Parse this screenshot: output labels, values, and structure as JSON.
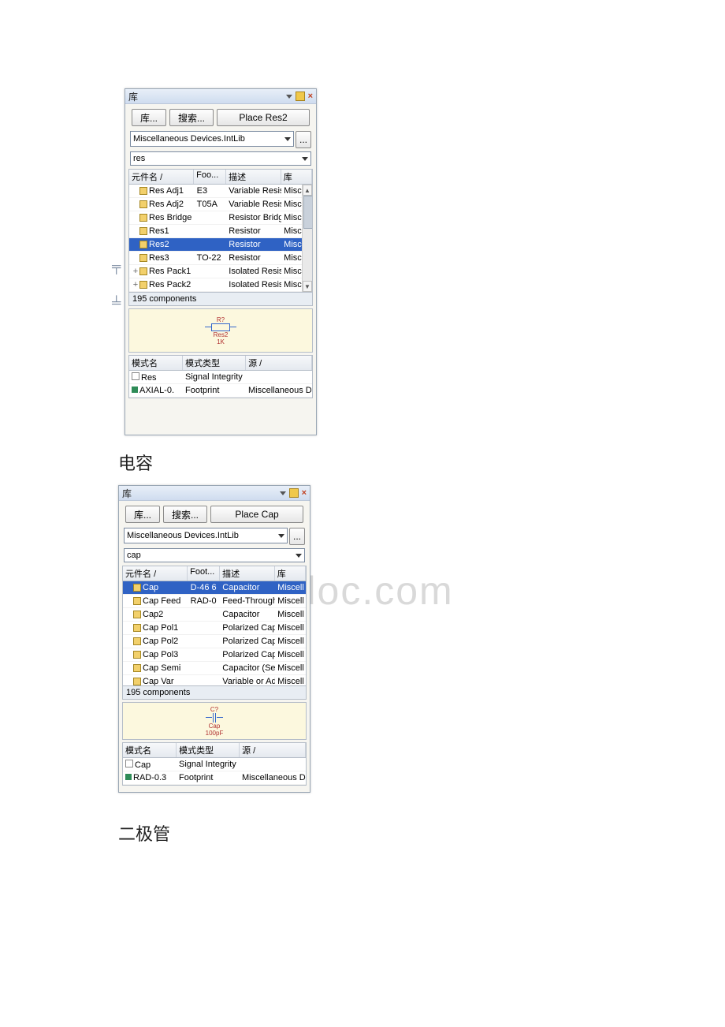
{
  "captions": {
    "capacitor": "电容",
    "diode": "二极管"
  },
  "watermark": "ingdoc.com",
  "panel1": {
    "title": "库",
    "toolbar": {
      "library_btn": "库...",
      "search_btn": "搜索...",
      "place_btn": "Place Res2"
    },
    "lib_select": "Miscellaneous Devices.IntLib",
    "more_btn": "...",
    "filter_value": "res",
    "columns": {
      "name": "元件名",
      "sort": "/",
      "foot": "Foo...",
      "desc": "描述",
      "lib": "库"
    },
    "rows": [
      {
        "tree": "",
        "name": "Res Adj1",
        "foot": "E3",
        "desc": "Variable Resis",
        "lib": "Miscell",
        "sel": false
      },
      {
        "tree": "",
        "name": "Res Adj2",
        "foot": "T05A",
        "desc": "Variable Resis",
        "lib": "Miscell",
        "sel": false
      },
      {
        "tree": "",
        "name": "Res Bridge",
        "foot": "",
        "desc": "Resistor Bridg",
        "lib": "Miscell",
        "sel": false
      },
      {
        "tree": "",
        "name": "Res1",
        "foot": "",
        "desc": "Resistor",
        "lib": "Miscell",
        "sel": false
      },
      {
        "tree": "",
        "name": "Res2",
        "foot": "",
        "desc": "Resistor",
        "lib": "Miscell",
        "sel": true
      },
      {
        "tree": "",
        "name": "Res3",
        "foot": "TO-22",
        "desc": "Resistor",
        "lib": "Miscell",
        "sel": false
      },
      {
        "tree": "+",
        "name": "Res Pack1",
        "foot": "",
        "desc": "Isolated Resis",
        "lib": "Miscell",
        "sel": false
      },
      {
        "tree": "+",
        "name": "Res Pack2",
        "foot": "",
        "desc": "Isolated Resis",
        "lib": "Miscell",
        "sel": false
      }
    ],
    "count_text": "195 components",
    "preview": {
      "designator": "R?",
      "comment": "Res2",
      "value": "1K"
    },
    "models": {
      "columns": {
        "name": "模式名",
        "type": "模式类型",
        "src": "源",
        "sort": "/"
      },
      "rows": [
        {
          "icon": "sch",
          "name": "Res",
          "type": "Signal Integrity",
          "src": ""
        },
        {
          "icon": "fp",
          "name": "AXIAL-0.",
          "type": "Footprint",
          "src": "Miscellaneous D"
        }
      ]
    }
  },
  "panel2": {
    "title": "库",
    "toolbar": {
      "library_btn": "库...",
      "search_btn": "搜索...",
      "place_btn": "Place Cap"
    },
    "lib_select": "Miscellaneous Devices.IntLib",
    "more_btn": "...",
    "filter_value": "cap",
    "columns": {
      "name": "元件名",
      "sort": "/",
      "foot": "Foot...",
      "desc": "描述",
      "lib": "库"
    },
    "rows": [
      {
        "tree": "",
        "name": "Cap",
        "foot": "D-46 6",
        "desc": "Capacitor",
        "lib": "Miscell",
        "sel": true
      },
      {
        "tree": "",
        "name": "Cap Feed",
        "foot": "RAD-0",
        "desc": "Feed-Through",
        "lib": "Miscell",
        "sel": false
      },
      {
        "tree": "",
        "name": "Cap2",
        "foot": "",
        "desc": "Capacitor",
        "lib": "Miscell",
        "sel": false
      },
      {
        "tree": "",
        "name": "Cap Pol1",
        "foot": "",
        "desc": "Polarized Capa",
        "lib": "Miscell",
        "sel": false
      },
      {
        "tree": "",
        "name": "Cap Pol2",
        "foot": "",
        "desc": "Polarized Capa",
        "lib": "Miscell",
        "sel": false
      },
      {
        "tree": "",
        "name": "Cap Pol3",
        "foot": "",
        "desc": "Polarized Capa",
        "lib": "Miscell",
        "sel": false
      },
      {
        "tree": "",
        "name": "Cap Semi",
        "foot": "",
        "desc": "Capacitor (Ser",
        "lib": "Miscell",
        "sel": false
      },
      {
        "tree": "",
        "name": "Cap Var",
        "foot": "",
        "desc": "Variable or Adj",
        "lib": "Miscell",
        "sel": false
      }
    ],
    "count_text": "195 components",
    "preview": {
      "designator": "C?",
      "comment": "Cap",
      "value": "100pF"
    },
    "models": {
      "columns": {
        "name": "模式名",
        "type": "模式类型",
        "src": "源",
        "sort": "/"
      },
      "rows": [
        {
          "icon": "sch",
          "name": "Cap",
          "type": "Signal Integrity",
          "src": ""
        },
        {
          "icon": "fp",
          "name": "RAD-0.3",
          "type": "Footprint",
          "src": "Miscellaneous D"
        }
      ]
    }
  }
}
